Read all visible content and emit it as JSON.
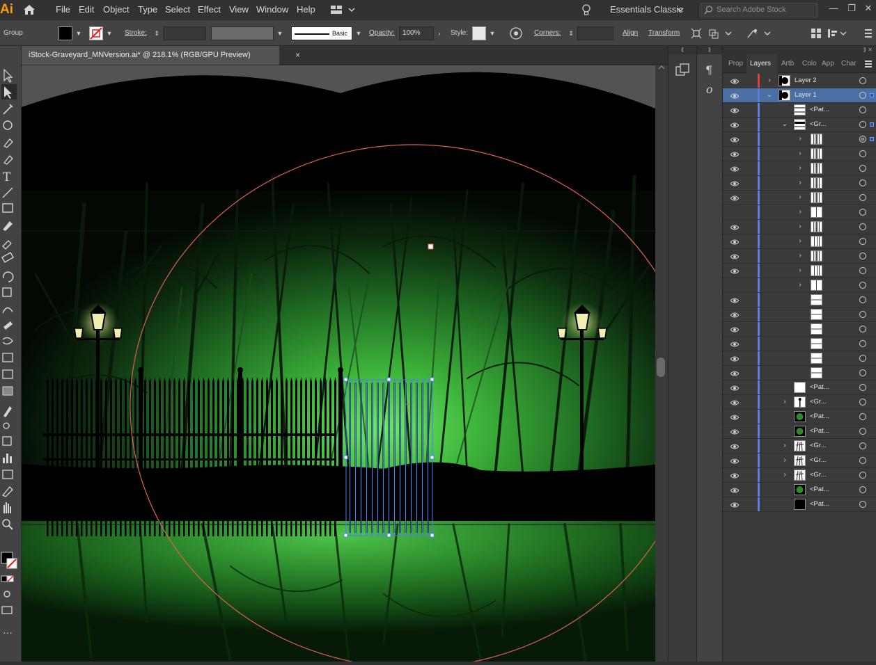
{
  "app": {
    "logo": "Ai",
    "home_icon": "home-icon"
  },
  "menu": {
    "items": [
      "File",
      "Edit",
      "Object",
      "Type",
      "Select",
      "Effect",
      "View",
      "Window",
      "Help"
    ],
    "workspace": "Essentials Classic",
    "search_placeholder": "Search Adobe Stock"
  },
  "control": {
    "selection": "Group",
    "stroke_label": "Stroke:",
    "brush_label": "Basic",
    "opacity_label": "Opacity:",
    "opacity_value": "100%",
    "style_label": "Style:",
    "corners_label": "Corners:",
    "align_label": "Align",
    "transform_label": "Transform"
  },
  "document": {
    "tab_title": "iStock-Graveyard_MNVersion.ai* @ 218.1% (RGB/GPU Preview)",
    "close_icon": "×"
  },
  "layers_panel": {
    "tabs": [
      "Prop",
      "Layers",
      "Artb",
      "Colo",
      "App",
      "Char"
    ],
    "active_tab": "Layers",
    "rows": [
      {
        "name": "Layer 2",
        "depth": 0,
        "expand": "right",
        "thumb": "circle",
        "bar": "#e04040",
        "visible": true,
        "selected": false
      },
      {
        "name": "Layer 1",
        "depth": 0,
        "expand": "down",
        "thumb": "circle",
        "bar": "#5a7fe0",
        "visible": true,
        "selected": true
      },
      {
        "name": "<Pat...",
        "depth": 1,
        "expand": "",
        "thumb": "lines",
        "bar": "#5a7fe0",
        "visible": true
      },
      {
        "name": "<Gr...",
        "depth": 1,
        "expand": "down",
        "thumb": "lines-dark",
        "bar": "#5a7fe0",
        "visible": true
      },
      {
        "name": "",
        "depth": 2,
        "expand": "right",
        "thumb": "vbars",
        "bar": "#5a7fe0",
        "visible": true,
        "target": "double"
      },
      {
        "name": "",
        "depth": 2,
        "expand": "right",
        "thumb": "vbars",
        "bar": "#5a7fe0",
        "visible": true
      },
      {
        "name": "",
        "depth": 2,
        "expand": "right",
        "thumb": "vbars",
        "bar": "#5a7fe0",
        "visible": true
      },
      {
        "name": "",
        "depth": 2,
        "expand": "right",
        "thumb": "vbars",
        "bar": "#5a7fe0",
        "visible": true
      },
      {
        "name": "",
        "depth": 2,
        "expand": "right",
        "thumb": "vbars",
        "bar": "#5a7fe0",
        "visible": true
      },
      {
        "name": "",
        "depth": 2,
        "expand": "right",
        "thumb": "vbar1",
        "bar": "#5a7fe0",
        "visible": false
      },
      {
        "name": "",
        "depth": 2,
        "expand": "right",
        "thumb": "vbars",
        "bar": "#5a7fe0",
        "visible": true
      },
      {
        "name": "",
        "depth": 2,
        "expand": "right",
        "thumb": "vbars2",
        "bar": "#5a7fe0",
        "visible": true
      },
      {
        "name": "",
        "depth": 2,
        "expand": "right",
        "thumb": "vbars",
        "bar": "#5a7fe0",
        "visible": true
      },
      {
        "name": "",
        "depth": 2,
        "expand": "right",
        "thumb": "vbars2",
        "bar": "#5a7fe0",
        "visible": true
      },
      {
        "name": "",
        "depth": 2,
        "expand": "right",
        "thumb": "vbar1",
        "bar": "#5a7fe0",
        "visible": false
      },
      {
        "name": "",
        "depth": 2,
        "expand": "",
        "thumb": "hline",
        "bar": "#5a7fe0",
        "visible": true
      },
      {
        "name": "",
        "depth": 2,
        "expand": "",
        "thumb": "hline",
        "bar": "#5a7fe0",
        "visible": true
      },
      {
        "name": "",
        "depth": 2,
        "expand": "",
        "thumb": "hline",
        "bar": "#5a7fe0",
        "visible": true
      },
      {
        "name": "",
        "depth": 2,
        "expand": "",
        "thumb": "hline",
        "bar": "#5a7fe0",
        "visible": true
      },
      {
        "name": "",
        "depth": 2,
        "expand": "",
        "thumb": "hline",
        "bar": "#5a7fe0",
        "visible": true
      },
      {
        "name": "",
        "depth": 2,
        "expand": "",
        "thumb": "hline",
        "bar": "#5a7fe0",
        "visible": true
      },
      {
        "name": "<Pat...",
        "depth": 1,
        "expand": "",
        "thumb": "blank",
        "bar": "#5a7fe0",
        "visible": true
      },
      {
        "name": "<Gr...",
        "depth": 1,
        "expand": "right",
        "thumb": "lamp",
        "bar": "#5a7fe0",
        "visible": true
      },
      {
        "name": "<Pat...",
        "depth": 1,
        "expand": "",
        "thumb": "green",
        "bar": "#5a7fe0",
        "visible": true
      },
      {
        "name": "<Pat...",
        "depth": 1,
        "expand": "",
        "thumb": "green",
        "bar": "#5a7fe0",
        "visible": true
      },
      {
        "name": "<Gr...",
        "depth": 1,
        "expand": "right",
        "thumb": "trees",
        "bar": "#5a7fe0",
        "visible": true
      },
      {
        "name": "<Gr...",
        "depth": 1,
        "expand": "right",
        "thumb": "trees",
        "bar": "#5a7fe0",
        "visible": true
      },
      {
        "name": "<Gr...",
        "depth": 1,
        "expand": "right",
        "thumb": "trees",
        "bar": "#5a7fe0",
        "visible": true
      },
      {
        "name": "<Pat...",
        "depth": 1,
        "expand": "",
        "thumb": "green",
        "bar": "#5a7fe0",
        "visible": true
      },
      {
        "name": "<Pat...",
        "depth": 1,
        "expand": "",
        "thumb": "black",
        "bar": "#5a7fe0",
        "visible": true
      }
    ]
  },
  "colors": {
    "accent": "#4a6fa5",
    "selection_blue": "#4c7ef0",
    "guide_red": "#e06050",
    "glow_green": "#5fcf5a"
  }
}
